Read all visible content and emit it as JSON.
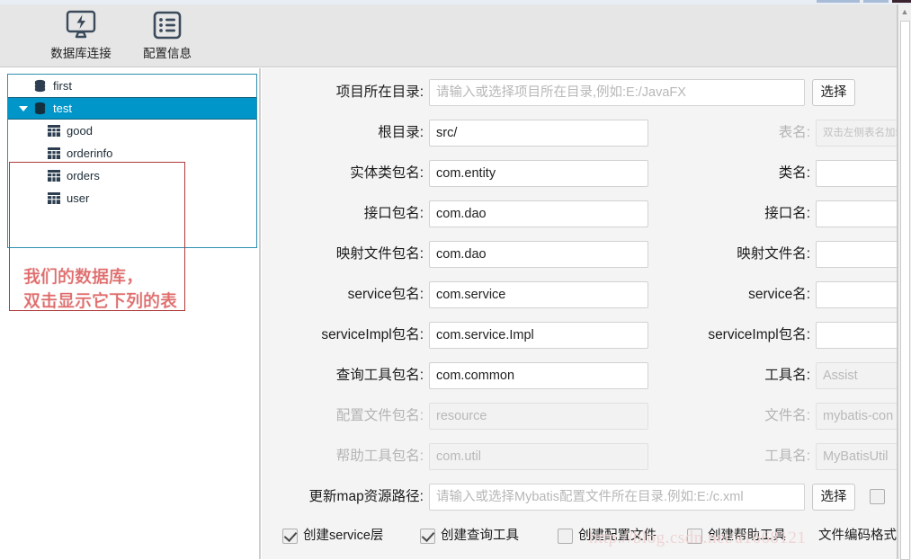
{
  "window": {
    "titlebar_note": "partial window titlebar strip"
  },
  "toolbar": {
    "buttons": [
      {
        "label": "数据库连接",
        "icon": "monitor-lightning-icon"
      },
      {
        "label": "配置信息",
        "icon": "list-form-icon"
      }
    ]
  },
  "sidebar": {
    "tree": [
      {
        "label": "first",
        "icon": "database-icon",
        "level": 0,
        "selected": false,
        "expanded": false
      },
      {
        "label": "test",
        "icon": "database-icon",
        "level": 0,
        "selected": true,
        "expanded": true
      },
      {
        "label": "good",
        "icon": "table-icon",
        "level": 1,
        "selected": false
      },
      {
        "label": "orderinfo",
        "icon": "table-icon",
        "level": 1,
        "selected": false
      },
      {
        "label": "orders",
        "icon": "table-icon",
        "level": 1,
        "selected": false
      },
      {
        "label": "user",
        "icon": "table-icon",
        "level": 1,
        "selected": false
      }
    ],
    "annotation": "我们的数据库，\n双击显示它下列的表",
    "annotation_color": "#e26a6a"
  },
  "form": {
    "rows": [
      {
        "left_label": "项目所在目录:",
        "left_value": "",
        "left_placeholder": "请输入或选择项目所在目录,例如:E:/JavaFX",
        "left_disabled": false,
        "button": "选择"
      },
      {
        "left_label": "根目录:",
        "left_value": "src/",
        "left_disabled": false,
        "right_label": "表名:",
        "right_value": "",
        "right_placeholder": "双击左侧表名加载",
        "right_disabled": true
      },
      {
        "left_label": "实体类包名:",
        "left_value": "com.entity",
        "left_disabled": false,
        "right_label": "类名:",
        "right_value": "",
        "right_disabled": false
      },
      {
        "left_label": "接口包名:",
        "left_value": "com.dao",
        "left_disabled": false,
        "right_label": "接口名:",
        "right_value": "",
        "right_disabled": false
      },
      {
        "left_label": "映射文件包名:",
        "left_value": "com.dao",
        "left_disabled": false,
        "right_label": "映射文件名:",
        "right_value": "",
        "right_disabled": false
      },
      {
        "left_label": "service包名:",
        "left_value": "com.service",
        "left_disabled": false,
        "right_label": "service名:",
        "right_value": "",
        "right_disabled": false
      },
      {
        "left_label": "serviceImpl包名:",
        "left_value": "com.service.Impl",
        "left_disabled": false,
        "right_label": "serviceImpl包名:",
        "right_value": "",
        "right_disabled": false
      },
      {
        "left_label": "查询工具包名:",
        "left_value": "com.common",
        "left_disabled": false,
        "right_label": "工具名:",
        "right_value": "Assist",
        "right_disabled": true
      },
      {
        "left_label": "配置文件包名:",
        "left_value": "resource",
        "left_disabled": true,
        "right_label": "文件名:",
        "right_value": "mybatis-con",
        "right_disabled": true
      },
      {
        "left_label": "帮助工具包名:",
        "left_value": "com.util",
        "left_disabled": true,
        "right_label": "工具名:",
        "right_value": "MyBatisUtil",
        "right_disabled": true
      }
    ],
    "map_row": {
      "label": "更新map资源路径:",
      "value": "",
      "placeholder": "请输入或选择Mybatis配置文件所在目录.例如:E:/c.xml",
      "button": "选择"
    },
    "checkboxes": [
      {
        "label": "创建service层",
        "checked": true
      },
      {
        "label": "创建查询工具",
        "checked": true
      },
      {
        "label": "创建配置文件",
        "checked": false
      },
      {
        "label": "创建帮助工具",
        "checked": false
      }
    ],
    "encoding_label": "文件编码格式"
  },
  "watermark": "http://blog.csdn.net/a1668121",
  "colors": {
    "selected_row": "#0096c9",
    "tree_border": "#2f8fb0",
    "annotation": "#e26a6a",
    "toolbar_bg": "#e6e6e6",
    "panel_bg": "#f4f4f4",
    "icon": "#3b4a5a"
  }
}
